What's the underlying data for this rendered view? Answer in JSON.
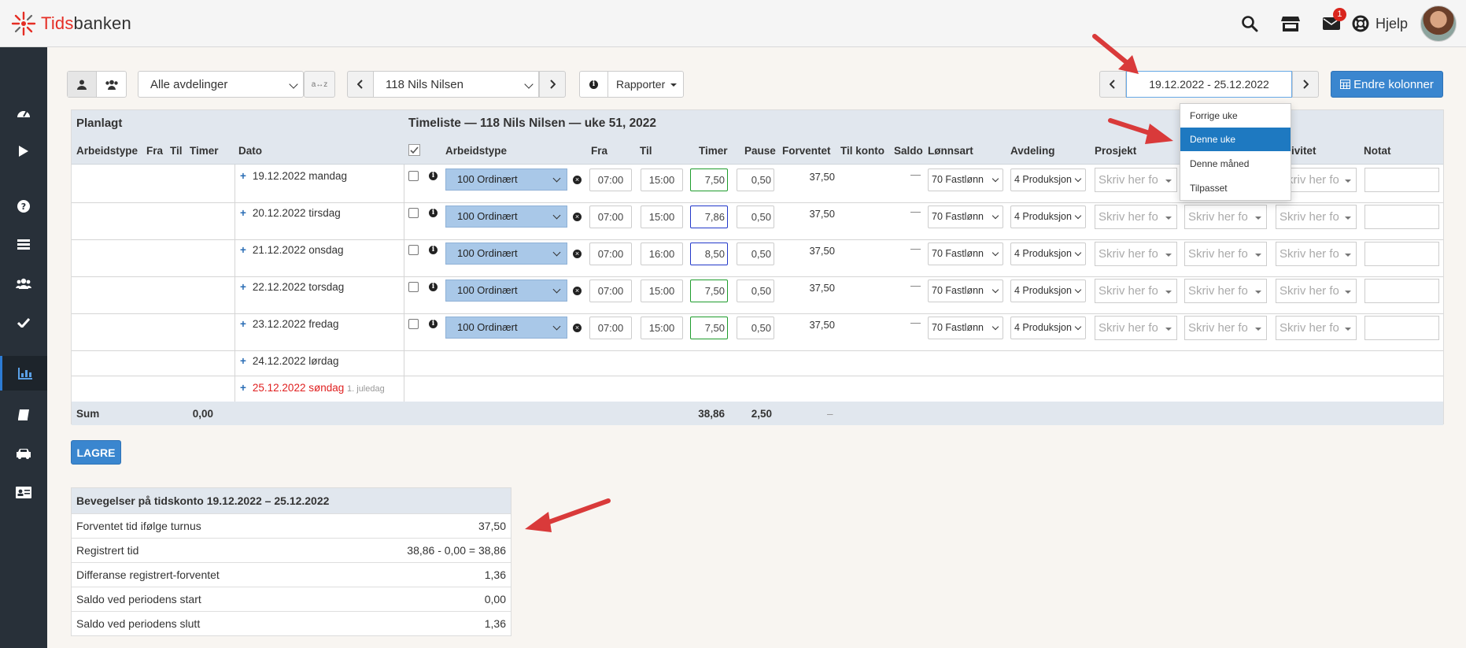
{
  "app": {
    "logo_red": "Tids",
    "logo_dark": "banken",
    "help_label": "Hjelp",
    "mail_badge": "1"
  },
  "sidebar": {
    "items": [
      {
        "icon": "dashboard-icon"
      },
      {
        "icon": "play-icon"
      },
      {
        "icon": "question-icon"
      },
      {
        "icon": "list-icon"
      },
      {
        "icon": "users-icon"
      },
      {
        "icon": "check-icon"
      },
      {
        "icon": "bar-chart-icon",
        "active": true
      },
      {
        "icon": "book-icon"
      },
      {
        "icon": "car-icon"
      },
      {
        "icon": "id-card-icon"
      }
    ]
  },
  "toolbar": {
    "department": "Alle avdelinger",
    "sort_label": "a↔z",
    "employee": "118 Nils Nilsen",
    "reports": "Rapporter",
    "period": "19.12.2022 - 25.12.2022",
    "change_columns": "Endre kolonner"
  },
  "period_menu": {
    "items": [
      "Forrige uke",
      "Denne uke",
      "Denne måned",
      "Tilpasset"
    ],
    "active": "Denne uke"
  },
  "table": {
    "left_title": "Planlagt",
    "right_title": "Timeliste — 118 Nils Nilsen — uke 51, 2022",
    "headers": {
      "arbeidstype_left": "Arbeidstype",
      "fra_left": "Fra",
      "til_left": "Til",
      "timer_left": "Timer",
      "dato": "Dato",
      "arbeidstype": "Arbeidstype",
      "fra": "Fra",
      "til": "Til",
      "timer": "Timer",
      "pause": "Pause",
      "forventet": "Forventet",
      "til_konto": "Til konto",
      "saldo": "Saldo",
      "lonnsart": "Lønnsart",
      "avdeling": "Avdeling",
      "prosjekt": "Prosjekt",
      "aktivitet": "ivitet",
      "notat": "Notat"
    },
    "rows": [
      {
        "date": "19.12.2022 mandag",
        "type": "100 Ordinært",
        "fra": "07:00",
        "til": "15:00",
        "timer": "7,50",
        "pause": "0,50",
        "forventet": "37,50",
        "saldo": "—",
        "lonnsart": "70 Fastlønn",
        "avdeling": "4 Produksjon",
        "placeholder": "Skriv her fo"
      },
      {
        "date": "20.12.2022 tirsdag",
        "type": "100 Ordinært",
        "fra": "07:00",
        "til": "15:00",
        "timer": "7,86",
        "pause": "0,50",
        "forventet": "37,50",
        "saldo": "—",
        "lonnsart": "70 Fastlønn",
        "avdeling": "4 Produksjon",
        "placeholder": "Skriv her fo"
      },
      {
        "date": "21.12.2022 onsdag",
        "type": "100 Ordinært",
        "fra": "07:00",
        "til": "16:00",
        "timer": "8,50",
        "pause": "0,50",
        "forventet": "37,50",
        "saldo": "—",
        "lonnsart": "70 Fastlønn",
        "avdeling": "4 Produksjon",
        "placeholder": "Skriv her fo"
      },
      {
        "date": "22.12.2022 torsdag",
        "type": "100 Ordinært",
        "fra": "07:00",
        "til": "15:00",
        "timer": "7,50",
        "pause": "0,50",
        "forventet": "37,50",
        "saldo": "—",
        "lonnsart": "70 Fastlønn",
        "avdeling": "4 Produksjon",
        "placeholder": "Skriv her fo"
      },
      {
        "date": "23.12.2022 fredag",
        "type": "100 Ordinært",
        "fra": "07:00",
        "til": "15:00",
        "timer": "7,50",
        "pause": "0,50",
        "forventet": "37,50",
        "saldo": "—",
        "lonnsart": "70 Fastlønn",
        "avdeling": "4 Produksjon",
        "placeholder": "Skriv her fo"
      }
    ],
    "weekend": [
      {
        "date": "24.12.2022 lørdag",
        "note": ""
      },
      {
        "date": "25.12.2022 søndag",
        "note": "1. juledag"
      }
    ],
    "sum": {
      "label": "Sum",
      "planned_timer": "0,00",
      "timer": "38,86",
      "pause": "2,50",
      "forventet": "–"
    }
  },
  "save_label": "LAGRE",
  "movements": {
    "title": "Bevegelser på tidskonto 19.12.2022 – 25.12.2022",
    "rows": [
      {
        "label": "Forventet tid ifølge turnus",
        "value": "37,50"
      },
      {
        "label": "Registrert tid",
        "value": "38,86 - 0,00 = 38,86"
      },
      {
        "label": "Differanse registrert-forventet",
        "value": "1,36"
      },
      {
        "label": "Saldo ved periodens start",
        "value": "0,00"
      },
      {
        "label": "Saldo ved periodens slutt",
        "value": "1,36"
      }
    ]
  },
  "colors": {
    "accent": "#3a86cf",
    "sidebar": "#283039",
    "arrow": "#d93a3a",
    "sunday": "#e02020"
  }
}
